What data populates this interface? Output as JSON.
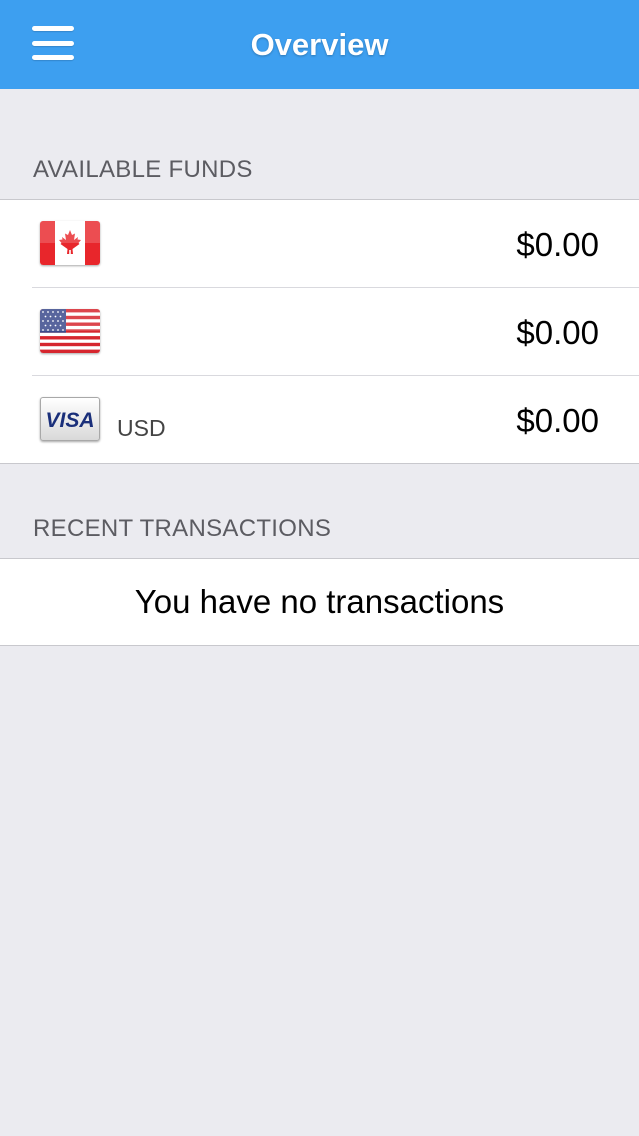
{
  "header": {
    "title": "Overview",
    "menu_icon": "hamburger-menu-icon"
  },
  "funds": {
    "section_title": "AVAILABLE FUNDS",
    "items": [
      {
        "icon": "canada-flag-icon",
        "currency_label": "",
        "amount": "$0.00"
      },
      {
        "icon": "usa-flag-icon",
        "currency_label": "",
        "amount": "$0.00"
      },
      {
        "icon": "visa-card-icon",
        "currency_label": "USD",
        "amount": "$0.00"
      }
    ]
  },
  "transactions": {
    "section_title": "RECENT TRANSACTIONS",
    "empty_message": "You have no transactions"
  },
  "colors": {
    "navbar": "#3d9ff0",
    "background": "#ebebf0"
  }
}
